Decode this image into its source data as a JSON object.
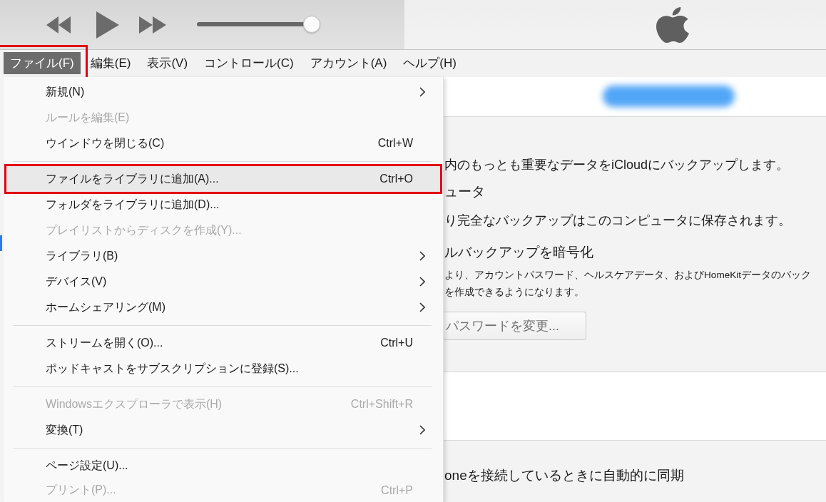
{
  "toolbar": {
    "volume": {
      "level": 0.93
    }
  },
  "menu_bar": [
    {
      "label": "ファイル(F)",
      "selected": true,
      "annotated": true
    },
    {
      "label": "編集(E)",
      "selected": false,
      "annotated": false
    },
    {
      "label": "表示(V)",
      "selected": false,
      "annotated": false
    },
    {
      "label": "コントロール(C)",
      "selected": false,
      "annotated": false
    },
    {
      "label": "アカウント(A)",
      "selected": false,
      "annotated": false
    },
    {
      "label": "ヘルプ(H)",
      "selected": false,
      "annotated": false
    }
  ],
  "file_menu": {
    "items": [
      {
        "kind": "item",
        "label": "新規(N)",
        "disabled": false,
        "submenu": true,
        "selected": false,
        "annotated": false
      },
      {
        "kind": "item",
        "label": "ルールを編集(E)",
        "disabled": true,
        "submenu": false,
        "selected": false,
        "annotated": false
      },
      {
        "kind": "item",
        "label": "ウインドウを閉じる(C)",
        "shortcut": "Ctrl+W",
        "disabled": false,
        "submenu": false,
        "selected": false,
        "annotated": false
      },
      {
        "kind": "separator"
      },
      {
        "kind": "item",
        "label": "ファイルをライブラリに追加(A)...",
        "shortcut": "Ctrl+O",
        "disabled": false,
        "submenu": false,
        "selected": true,
        "annotated": true
      },
      {
        "kind": "item",
        "label": "フォルダをライブラリに追加(D)...",
        "disabled": false,
        "submenu": false,
        "selected": false,
        "annotated": false
      },
      {
        "kind": "item",
        "label": "プレイリストからディスクを作成(Y)...",
        "disabled": true,
        "submenu": false,
        "selected": false,
        "annotated": false
      },
      {
        "kind": "item",
        "label": "ライブラリ(B)",
        "disabled": false,
        "submenu": true,
        "selected": false,
        "annotated": false
      },
      {
        "kind": "item",
        "label": "デバイス(V)",
        "disabled": false,
        "submenu": true,
        "selected": false,
        "annotated": false
      },
      {
        "kind": "item",
        "label": "ホームシェアリング(M)",
        "disabled": false,
        "submenu": true,
        "selected": false,
        "annotated": false
      },
      {
        "kind": "separator"
      },
      {
        "kind": "item",
        "label": "ストリームを開く(O)...",
        "shortcut": "Ctrl+U",
        "disabled": false,
        "submenu": false,
        "selected": false,
        "annotated": false
      },
      {
        "kind": "item",
        "label": "ポッドキャストをサブスクリプションに登録(S)...",
        "disabled": false,
        "submenu": false,
        "selected": false,
        "annotated": false
      },
      {
        "kind": "separator"
      },
      {
        "kind": "item",
        "label": "Windowsエクスプローラで表示(H)",
        "shortcut": "Ctrl+Shift+R",
        "disabled": true,
        "submenu": false,
        "selected": false,
        "annotated": false
      },
      {
        "kind": "item",
        "label": "変換(T)",
        "disabled": false,
        "submenu": true,
        "selected": false,
        "annotated": false
      },
      {
        "kind": "separator"
      },
      {
        "kind": "item",
        "label": "ページ設定(U)...",
        "disabled": false,
        "submenu": false,
        "selected": false,
        "annotated": false
      },
      {
        "kind": "item",
        "label": "プリント(P)...",
        "shortcut": "Ctrl+P",
        "disabled": true,
        "submenu": false,
        "selected": false,
        "annotated": false
      }
    ]
  },
  "backup": {
    "icloud_text": "内のもっとも重要なデータをiCloudにバックアップします。",
    "computer_heading": "ュータ",
    "computer_text": "り完全なバックアップはこのコンピュータに保存されます。",
    "encrypt_heading": "ルバックアップを暗号化",
    "encrypt_text": [
      "より、アカウントパスワード、ヘルスケアデータ、およびHomeKitデータのバック",
      "を作成できるようになります。"
    ],
    "change_password_button": {
      "label": "パスワードを変更...",
      "disabled": true
    }
  },
  "options": {
    "sync_text": "oneを接続しているときに自動的に同期"
  }
}
